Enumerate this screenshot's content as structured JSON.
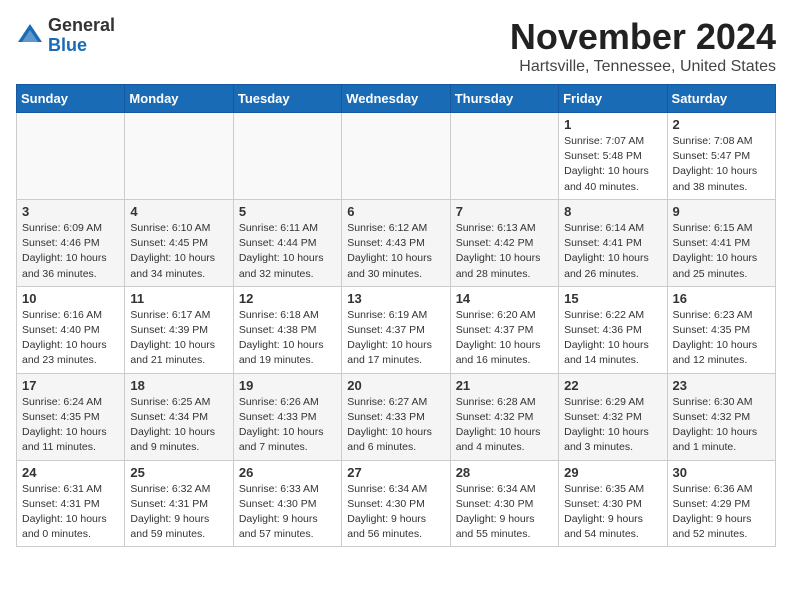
{
  "header": {
    "logo_general": "General",
    "logo_blue": "Blue",
    "month_title": "November 2024",
    "location": "Hartsville, Tennessee, United States"
  },
  "weekdays": [
    "Sunday",
    "Monday",
    "Tuesday",
    "Wednesday",
    "Thursday",
    "Friday",
    "Saturday"
  ],
  "weeks": [
    [
      {
        "day": "",
        "info": ""
      },
      {
        "day": "",
        "info": ""
      },
      {
        "day": "",
        "info": ""
      },
      {
        "day": "",
        "info": ""
      },
      {
        "day": "",
        "info": ""
      },
      {
        "day": "1",
        "info": "Sunrise: 7:07 AM\nSunset: 5:48 PM\nDaylight: 10 hours and 40 minutes."
      },
      {
        "day": "2",
        "info": "Sunrise: 7:08 AM\nSunset: 5:47 PM\nDaylight: 10 hours and 38 minutes."
      }
    ],
    [
      {
        "day": "3",
        "info": "Sunrise: 6:09 AM\nSunset: 4:46 PM\nDaylight: 10 hours and 36 minutes."
      },
      {
        "day": "4",
        "info": "Sunrise: 6:10 AM\nSunset: 4:45 PM\nDaylight: 10 hours and 34 minutes."
      },
      {
        "day": "5",
        "info": "Sunrise: 6:11 AM\nSunset: 4:44 PM\nDaylight: 10 hours and 32 minutes."
      },
      {
        "day": "6",
        "info": "Sunrise: 6:12 AM\nSunset: 4:43 PM\nDaylight: 10 hours and 30 minutes."
      },
      {
        "day": "7",
        "info": "Sunrise: 6:13 AM\nSunset: 4:42 PM\nDaylight: 10 hours and 28 minutes."
      },
      {
        "day": "8",
        "info": "Sunrise: 6:14 AM\nSunset: 4:41 PM\nDaylight: 10 hours and 26 minutes."
      },
      {
        "day": "9",
        "info": "Sunrise: 6:15 AM\nSunset: 4:41 PM\nDaylight: 10 hours and 25 minutes."
      }
    ],
    [
      {
        "day": "10",
        "info": "Sunrise: 6:16 AM\nSunset: 4:40 PM\nDaylight: 10 hours and 23 minutes."
      },
      {
        "day": "11",
        "info": "Sunrise: 6:17 AM\nSunset: 4:39 PM\nDaylight: 10 hours and 21 minutes."
      },
      {
        "day": "12",
        "info": "Sunrise: 6:18 AM\nSunset: 4:38 PM\nDaylight: 10 hours and 19 minutes."
      },
      {
        "day": "13",
        "info": "Sunrise: 6:19 AM\nSunset: 4:37 PM\nDaylight: 10 hours and 17 minutes."
      },
      {
        "day": "14",
        "info": "Sunrise: 6:20 AM\nSunset: 4:37 PM\nDaylight: 10 hours and 16 minutes."
      },
      {
        "day": "15",
        "info": "Sunrise: 6:22 AM\nSunset: 4:36 PM\nDaylight: 10 hours and 14 minutes."
      },
      {
        "day": "16",
        "info": "Sunrise: 6:23 AM\nSunset: 4:35 PM\nDaylight: 10 hours and 12 minutes."
      }
    ],
    [
      {
        "day": "17",
        "info": "Sunrise: 6:24 AM\nSunset: 4:35 PM\nDaylight: 10 hours and 11 minutes."
      },
      {
        "day": "18",
        "info": "Sunrise: 6:25 AM\nSunset: 4:34 PM\nDaylight: 10 hours and 9 minutes."
      },
      {
        "day": "19",
        "info": "Sunrise: 6:26 AM\nSunset: 4:33 PM\nDaylight: 10 hours and 7 minutes."
      },
      {
        "day": "20",
        "info": "Sunrise: 6:27 AM\nSunset: 4:33 PM\nDaylight: 10 hours and 6 minutes."
      },
      {
        "day": "21",
        "info": "Sunrise: 6:28 AM\nSunset: 4:32 PM\nDaylight: 10 hours and 4 minutes."
      },
      {
        "day": "22",
        "info": "Sunrise: 6:29 AM\nSunset: 4:32 PM\nDaylight: 10 hours and 3 minutes."
      },
      {
        "day": "23",
        "info": "Sunrise: 6:30 AM\nSunset: 4:32 PM\nDaylight: 10 hours and 1 minute."
      }
    ],
    [
      {
        "day": "24",
        "info": "Sunrise: 6:31 AM\nSunset: 4:31 PM\nDaylight: 10 hours and 0 minutes."
      },
      {
        "day": "25",
        "info": "Sunrise: 6:32 AM\nSunset: 4:31 PM\nDaylight: 9 hours and 59 minutes."
      },
      {
        "day": "26",
        "info": "Sunrise: 6:33 AM\nSunset: 4:30 PM\nDaylight: 9 hours and 57 minutes."
      },
      {
        "day": "27",
        "info": "Sunrise: 6:34 AM\nSunset: 4:30 PM\nDaylight: 9 hours and 56 minutes."
      },
      {
        "day": "28",
        "info": "Sunrise: 6:34 AM\nSunset: 4:30 PM\nDaylight: 9 hours and 55 minutes."
      },
      {
        "day": "29",
        "info": "Sunrise: 6:35 AM\nSunset: 4:30 PM\nDaylight: 9 hours and 54 minutes."
      },
      {
        "day": "30",
        "info": "Sunrise: 6:36 AM\nSunset: 4:29 PM\nDaylight: 9 hours and 52 minutes."
      }
    ]
  ]
}
